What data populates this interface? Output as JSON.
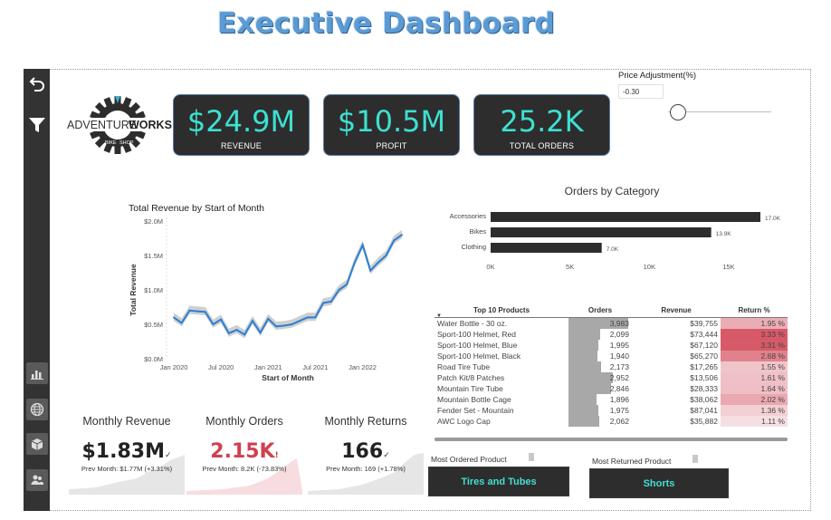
{
  "header": {
    "title": "Executive Dashboard"
  },
  "sidebar": {
    "items": [
      {
        "icon": "back-arrow-icon"
      },
      {
        "icon": "filter-icon"
      },
      {
        "icon": "bar-chart-icon"
      },
      {
        "icon": "globe-icon"
      },
      {
        "icon": "box-icon"
      },
      {
        "icon": "people-icon"
      }
    ]
  },
  "logo": {
    "brand_left": "ADVENTURE",
    "brand_right": "WORKS",
    "bike": "BIKE",
    "shop": "SHOP"
  },
  "kpis": [
    {
      "value": "$24.9M",
      "label": "REVENUE"
    },
    {
      "value": "$10.5M",
      "label": "PROFIT"
    },
    {
      "value": "25.2K",
      "label": "TOTAL ORDERS"
    }
  ],
  "price_adjustment": {
    "title": "Price Adjustment(%)",
    "value": "-0.30",
    "slider_fraction": 0.1
  },
  "colors": {
    "accent": "#3de0d0",
    "card_bg": "#2d2d2d",
    "line": "#2a7fd4",
    "negative": "#d04050",
    "title": "#5B9BD5"
  },
  "revenue_chart": {
    "title": "Total Revenue by Start of Month",
    "xlabel": "Start of Month",
    "ylabel": "Total Revenue",
    "y_ticks": [
      "$0.0M",
      "$0.5M",
      "$1.0M",
      "$1.5M",
      "$2.0M"
    ],
    "x_ticks": [
      "Jan 2020",
      "Jul 2020",
      "Jan 2021",
      "Jul 2021",
      "Jan 2022"
    ]
  },
  "chart_data": [
    {
      "type": "line",
      "title": "Total Revenue by Start of Month",
      "xlabel": "Start of Month",
      "ylabel": "Total Revenue",
      "ylim": [
        0,
        2.0
      ],
      "y_unit": "$M",
      "x": [
        "2020-01",
        "2020-02",
        "2020-03",
        "2020-04",
        "2020-05",
        "2020-06",
        "2020-07",
        "2020-08",
        "2020-09",
        "2020-10",
        "2020-11",
        "2020-12",
        "2021-01",
        "2021-02",
        "2021-03",
        "2021-04",
        "2021-05",
        "2021-06",
        "2021-07",
        "2021-08",
        "2021-09",
        "2021-10",
        "2021-11",
        "2021-12",
        "2022-01",
        "2022-02",
        "2022-03",
        "2022-04",
        "2022-05",
        "2022-06"
      ],
      "series": [
        {
          "values": [
            0.6,
            0.52,
            0.7,
            0.69,
            0.68,
            0.5,
            0.57,
            0.37,
            0.42,
            0.35,
            0.55,
            0.38,
            0.58,
            0.47,
            0.48,
            0.5,
            0.55,
            0.6,
            0.6,
            0.81,
            0.83,
            1.0,
            1.08,
            1.4,
            1.65,
            1.28,
            1.4,
            1.5,
            1.72,
            1.8
          ]
        }
      ]
    },
    {
      "type": "bar",
      "orientation": "horizontal",
      "title": "Orders by Category",
      "categories": [
        "Accessories",
        "Bikes",
        "Clothing"
      ],
      "values": [
        17.0,
        13.9,
        7.0
      ],
      "value_labels": [
        "17.0K",
        "13.9K",
        "7.0K"
      ],
      "x_ticks": [
        "0K",
        "5K",
        "10K",
        "15K"
      ],
      "xlim": [
        0,
        17.0
      ]
    }
  ],
  "category_chart": {
    "title": "Orders by Category"
  },
  "top_products": {
    "headers": [
      "Top 10 Products",
      "Orders",
      "Revenue",
      "Return %"
    ],
    "rows": [
      {
        "name": "Water Bottle - 30 oz.",
        "orders": "3,983",
        "orders_num": 3983,
        "revenue": "$39,755",
        "return": "1.95 %",
        "return_num": 1.95
      },
      {
        "name": "Sport-100 Helmet, Red",
        "orders": "2,099",
        "orders_num": 2099,
        "revenue": "$73,444",
        "return": "3.33 %",
        "return_num": 3.33
      },
      {
        "name": "Sport-100 Helmet, Blue",
        "orders": "1,995",
        "orders_num": 1995,
        "revenue": "$67,120",
        "return": "3.31 %",
        "return_num": 3.31
      },
      {
        "name": "Sport-100 Helmet, Black",
        "orders": "1,940",
        "orders_num": 1940,
        "revenue": "$65,270",
        "return": "2.68 %",
        "return_num": 2.68
      },
      {
        "name": "Road Tire Tube",
        "orders": "2,173",
        "orders_num": 2173,
        "revenue": "$17,265",
        "return": "1.55 %",
        "return_num": 1.55
      },
      {
        "name": "Patch Kit/8 Patches",
        "orders": "2,952",
        "orders_num": 2952,
        "revenue": "$13,506",
        "return": "1.61 %",
        "return_num": 1.61
      },
      {
        "name": "Mountain Tire Tube",
        "orders": "2,846",
        "orders_num": 2846,
        "revenue": "$28,333",
        "return": "1.64 %",
        "return_num": 1.64
      },
      {
        "name": "Mountain Bottle Cage",
        "orders": "1,896",
        "orders_num": 1896,
        "revenue": "$38,062",
        "return": "2.02 %",
        "return_num": 2.02
      },
      {
        "name": "Fender Set - Mountain",
        "orders": "1,975",
        "orders_num": 1975,
        "revenue": "$87,041",
        "return": "1.36 %",
        "return_num": 1.36
      },
      {
        "name": "AWC Logo Cap",
        "orders": "2,062",
        "orders_num": 2062,
        "revenue": "$35,882",
        "return": "1.11 %",
        "return_num": 1.11
      }
    ]
  },
  "monthly": [
    {
      "title": "Monthly Revenue",
      "value": "$1.83M",
      "mark": "✓",
      "sub": "Prev Month: $1.77M (+3.31%)",
      "negative": false
    },
    {
      "title": "Monthly Orders",
      "value": "2.15K",
      "mark": "!",
      "sub": "Prev Month: 8.2K (-73.83%)",
      "negative": true
    },
    {
      "title": "Monthly Returns",
      "value": "166",
      "mark": "✓",
      "sub": "Prev Month: 169 (+1.78%)",
      "negative": false
    }
  ],
  "most_ordered": {
    "label": "Most Ordered Product",
    "value": "Tires and Tubes"
  },
  "most_returned": {
    "label": "Most Returned Product",
    "value": "Shorts"
  }
}
